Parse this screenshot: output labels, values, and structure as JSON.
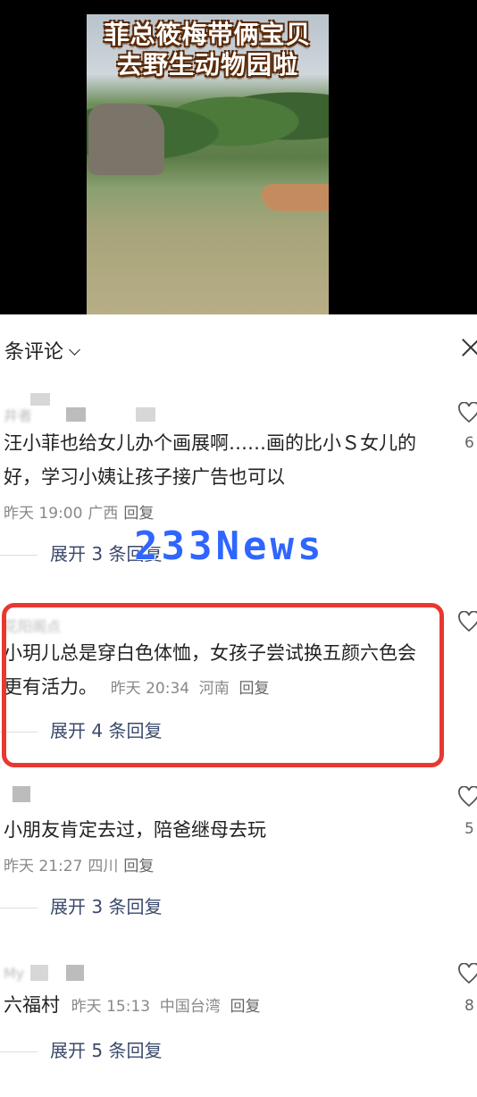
{
  "video": {
    "title_line1": "菲总筱梅带俩宝贝",
    "title_line2": "去野生动物园啦"
  },
  "panel": {
    "title": "条评论"
  },
  "watermark": "233News",
  "comments": [
    {
      "username": "井者",
      "text": "汪小菲也给女儿办个画展啊……画的比小Ｓ女儿的好，学习小姨让孩子接广告也可以",
      "time": "昨天 19:00",
      "location": "广西",
      "reply_label": "回复",
      "expand": "展开 3 条回复",
      "likes": "6"
    },
    {
      "username": "花阳阁点",
      "text": "小玥儿总是穿白色体恤，女孩子尝试换五颜六色会更有活力。",
      "time": "昨天 20:34",
      "location": "河南",
      "reply_label": "回复",
      "expand": "展开 4 条回复",
      "likes": ""
    },
    {
      "username": "",
      "text": "小朋友肯定去过，陪爸继母去玩",
      "time": "昨天 21:27",
      "location": "四川",
      "reply_label": "回复",
      "expand": "展开 3 条回复",
      "likes": "5"
    },
    {
      "username": "My",
      "text": "六福村",
      "time": "昨天 15:13",
      "location": "中国台湾",
      "reply_label": "回复",
      "expand": "展开 5 条回复",
      "likes": "8"
    }
  ]
}
